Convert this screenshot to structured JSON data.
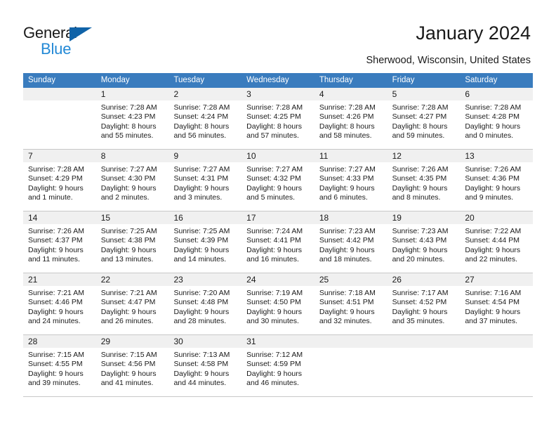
{
  "brand": {
    "name_top": "General",
    "name_bottom": "Blue",
    "accent_color": "#1063a8",
    "accent_color_light": "#2389d6",
    "triangle_icon": "triangle-icon"
  },
  "header": {
    "title": "January 2024",
    "subtitle": "Sherwood, Wisconsin, United States"
  },
  "calendar": {
    "header_bg": "#3a7cbe",
    "daynum_bg": "#f0f0f0",
    "weekdays": [
      "Sunday",
      "Monday",
      "Tuesday",
      "Wednesday",
      "Thursday",
      "Friday",
      "Saturday"
    ],
    "weeks": [
      [
        {
          "day": "",
          "sunrise": "",
          "sunset": "",
          "daylight1": "",
          "daylight2": ""
        },
        {
          "day": "1",
          "sunrise": "Sunrise: 7:28 AM",
          "sunset": "Sunset: 4:23 PM",
          "daylight1": "Daylight: 8 hours",
          "daylight2": "and 55 minutes."
        },
        {
          "day": "2",
          "sunrise": "Sunrise: 7:28 AM",
          "sunset": "Sunset: 4:24 PM",
          "daylight1": "Daylight: 8 hours",
          "daylight2": "and 56 minutes."
        },
        {
          "day": "3",
          "sunrise": "Sunrise: 7:28 AM",
          "sunset": "Sunset: 4:25 PM",
          "daylight1": "Daylight: 8 hours",
          "daylight2": "and 57 minutes."
        },
        {
          "day": "4",
          "sunrise": "Sunrise: 7:28 AM",
          "sunset": "Sunset: 4:26 PM",
          "daylight1": "Daylight: 8 hours",
          "daylight2": "and 58 minutes."
        },
        {
          "day": "5",
          "sunrise": "Sunrise: 7:28 AM",
          "sunset": "Sunset: 4:27 PM",
          "daylight1": "Daylight: 8 hours",
          "daylight2": "and 59 minutes."
        },
        {
          "day": "6",
          "sunrise": "Sunrise: 7:28 AM",
          "sunset": "Sunset: 4:28 PM",
          "daylight1": "Daylight: 9 hours",
          "daylight2": "and 0 minutes."
        }
      ],
      [
        {
          "day": "7",
          "sunrise": "Sunrise: 7:28 AM",
          "sunset": "Sunset: 4:29 PM",
          "daylight1": "Daylight: 9 hours",
          "daylight2": "and 1 minute."
        },
        {
          "day": "8",
          "sunrise": "Sunrise: 7:27 AM",
          "sunset": "Sunset: 4:30 PM",
          "daylight1": "Daylight: 9 hours",
          "daylight2": "and 2 minutes."
        },
        {
          "day": "9",
          "sunrise": "Sunrise: 7:27 AM",
          "sunset": "Sunset: 4:31 PM",
          "daylight1": "Daylight: 9 hours",
          "daylight2": "and 3 minutes."
        },
        {
          "day": "10",
          "sunrise": "Sunrise: 7:27 AM",
          "sunset": "Sunset: 4:32 PM",
          "daylight1": "Daylight: 9 hours",
          "daylight2": "and 5 minutes."
        },
        {
          "day": "11",
          "sunrise": "Sunrise: 7:27 AM",
          "sunset": "Sunset: 4:33 PM",
          "daylight1": "Daylight: 9 hours",
          "daylight2": "and 6 minutes."
        },
        {
          "day": "12",
          "sunrise": "Sunrise: 7:26 AM",
          "sunset": "Sunset: 4:35 PM",
          "daylight1": "Daylight: 9 hours",
          "daylight2": "and 8 minutes."
        },
        {
          "day": "13",
          "sunrise": "Sunrise: 7:26 AM",
          "sunset": "Sunset: 4:36 PM",
          "daylight1": "Daylight: 9 hours",
          "daylight2": "and 9 minutes."
        }
      ],
      [
        {
          "day": "14",
          "sunrise": "Sunrise: 7:26 AM",
          "sunset": "Sunset: 4:37 PM",
          "daylight1": "Daylight: 9 hours",
          "daylight2": "and 11 minutes."
        },
        {
          "day": "15",
          "sunrise": "Sunrise: 7:25 AM",
          "sunset": "Sunset: 4:38 PM",
          "daylight1": "Daylight: 9 hours",
          "daylight2": "and 13 minutes."
        },
        {
          "day": "16",
          "sunrise": "Sunrise: 7:25 AM",
          "sunset": "Sunset: 4:39 PM",
          "daylight1": "Daylight: 9 hours",
          "daylight2": "and 14 minutes."
        },
        {
          "day": "17",
          "sunrise": "Sunrise: 7:24 AM",
          "sunset": "Sunset: 4:41 PM",
          "daylight1": "Daylight: 9 hours",
          "daylight2": "and 16 minutes."
        },
        {
          "day": "18",
          "sunrise": "Sunrise: 7:23 AM",
          "sunset": "Sunset: 4:42 PM",
          "daylight1": "Daylight: 9 hours",
          "daylight2": "and 18 minutes."
        },
        {
          "day": "19",
          "sunrise": "Sunrise: 7:23 AM",
          "sunset": "Sunset: 4:43 PM",
          "daylight1": "Daylight: 9 hours",
          "daylight2": "and 20 minutes."
        },
        {
          "day": "20",
          "sunrise": "Sunrise: 7:22 AM",
          "sunset": "Sunset: 4:44 PM",
          "daylight1": "Daylight: 9 hours",
          "daylight2": "and 22 minutes."
        }
      ],
      [
        {
          "day": "21",
          "sunrise": "Sunrise: 7:21 AM",
          "sunset": "Sunset: 4:46 PM",
          "daylight1": "Daylight: 9 hours",
          "daylight2": "and 24 minutes."
        },
        {
          "day": "22",
          "sunrise": "Sunrise: 7:21 AM",
          "sunset": "Sunset: 4:47 PM",
          "daylight1": "Daylight: 9 hours",
          "daylight2": "and 26 minutes."
        },
        {
          "day": "23",
          "sunrise": "Sunrise: 7:20 AM",
          "sunset": "Sunset: 4:48 PM",
          "daylight1": "Daylight: 9 hours",
          "daylight2": "and 28 minutes."
        },
        {
          "day": "24",
          "sunrise": "Sunrise: 7:19 AM",
          "sunset": "Sunset: 4:50 PM",
          "daylight1": "Daylight: 9 hours",
          "daylight2": "and 30 minutes."
        },
        {
          "day": "25",
          "sunrise": "Sunrise: 7:18 AM",
          "sunset": "Sunset: 4:51 PM",
          "daylight1": "Daylight: 9 hours",
          "daylight2": "and 32 minutes."
        },
        {
          "day": "26",
          "sunrise": "Sunrise: 7:17 AM",
          "sunset": "Sunset: 4:52 PM",
          "daylight1": "Daylight: 9 hours",
          "daylight2": "and 35 minutes."
        },
        {
          "day": "27",
          "sunrise": "Sunrise: 7:16 AM",
          "sunset": "Sunset: 4:54 PM",
          "daylight1": "Daylight: 9 hours",
          "daylight2": "and 37 minutes."
        }
      ],
      [
        {
          "day": "28",
          "sunrise": "Sunrise: 7:15 AM",
          "sunset": "Sunset: 4:55 PM",
          "daylight1": "Daylight: 9 hours",
          "daylight2": "and 39 minutes."
        },
        {
          "day": "29",
          "sunrise": "Sunrise: 7:15 AM",
          "sunset": "Sunset: 4:56 PM",
          "daylight1": "Daylight: 9 hours",
          "daylight2": "and 41 minutes."
        },
        {
          "day": "30",
          "sunrise": "Sunrise: 7:13 AM",
          "sunset": "Sunset: 4:58 PM",
          "daylight1": "Daylight: 9 hours",
          "daylight2": "and 44 minutes."
        },
        {
          "day": "31",
          "sunrise": "Sunrise: 7:12 AM",
          "sunset": "Sunset: 4:59 PM",
          "daylight1": "Daylight: 9 hours",
          "daylight2": "and 46 minutes."
        },
        {
          "day": "",
          "sunrise": "",
          "sunset": "",
          "daylight1": "",
          "daylight2": ""
        },
        {
          "day": "",
          "sunrise": "",
          "sunset": "",
          "daylight1": "",
          "daylight2": ""
        },
        {
          "day": "",
          "sunrise": "",
          "sunset": "",
          "daylight1": "",
          "daylight2": ""
        }
      ]
    ]
  }
}
